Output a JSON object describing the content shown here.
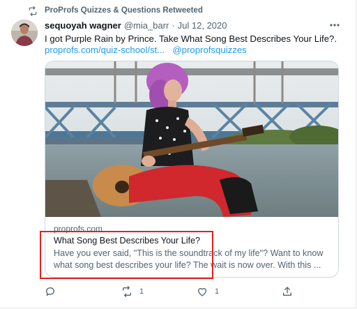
{
  "retweet_header": {
    "label": "ProProfs Quizzes & Questions Retweeted"
  },
  "author": {
    "display_name": "sequoyah wagner",
    "handle": "@mia_barr",
    "separator": "·",
    "date": "Jul 12, 2020"
  },
  "tweet": {
    "text": "I got Purple Rain by Prince. Take What Song Best Describes Your Life?.",
    "link_url": "proprofs.com/quiz-school/st...",
    "mention": "@proprofsquizzes"
  },
  "card": {
    "domain": "proprofs.com",
    "title": "What Song Best Describes Your Life?",
    "description": "Have you ever said, \"This is the soundtrack of my life\"? Want to know what song best describes your life? The wait is now over. With this ..."
  },
  "actions": {
    "reply_count": "",
    "retweet_count": "1",
    "like_count": "1"
  },
  "icons": [
    "retweet-icon",
    "more-icon",
    "reply-icon",
    "like-icon",
    "share-icon"
  ],
  "colors": {
    "link": "#1d9bf0",
    "secondary_text": "#536471",
    "highlight": "#e02020"
  }
}
